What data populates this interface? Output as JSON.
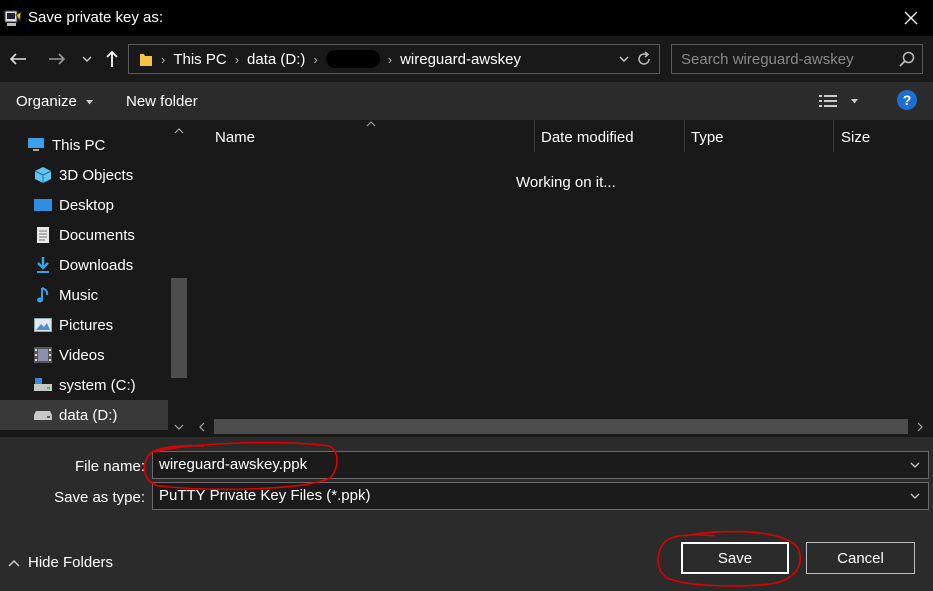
{
  "window": {
    "title": "Save private key as:"
  },
  "address": {
    "crumbs": [
      "This PC",
      "data (D:)",
      "wireguard-awskey"
    ]
  },
  "search": {
    "placeholder": "Search wireguard-awskey"
  },
  "toolbar": {
    "organize": "Organize",
    "new_folder": "New folder",
    "help": "?"
  },
  "sidebar": {
    "items": [
      {
        "label": "This PC",
        "icon": "computer-icon"
      },
      {
        "label": "3D Objects",
        "icon": "cube-icon"
      },
      {
        "label": "Desktop",
        "icon": "desktop-icon"
      },
      {
        "label": "Documents",
        "icon": "document-icon"
      },
      {
        "label": "Downloads",
        "icon": "download-icon"
      },
      {
        "label": "Music",
        "icon": "music-icon"
      },
      {
        "label": "Pictures",
        "icon": "picture-icon"
      },
      {
        "label": "Videos",
        "icon": "video-icon"
      },
      {
        "label": "system (C:)",
        "icon": "drive-icon"
      },
      {
        "label": "data (D:)",
        "icon": "drive-icon"
      }
    ],
    "selected": "data (D:)"
  },
  "file_list": {
    "columns": [
      "Name",
      "Date modified",
      "Type",
      "Size"
    ],
    "status": "Working on it..."
  },
  "form": {
    "file_name_label": "File name:",
    "file_name_value": "wireguard-awskey.ppk",
    "save_type_label": "Save as type:",
    "save_type_value": "PuTTY Private Key Files (*.ppk)"
  },
  "actions": {
    "hide_folders": "Hide Folders",
    "save": "Save",
    "cancel": "Cancel"
  },
  "colors": {
    "background": "#202020",
    "accent": "#1e6fd0",
    "annotation": "#e00000"
  }
}
